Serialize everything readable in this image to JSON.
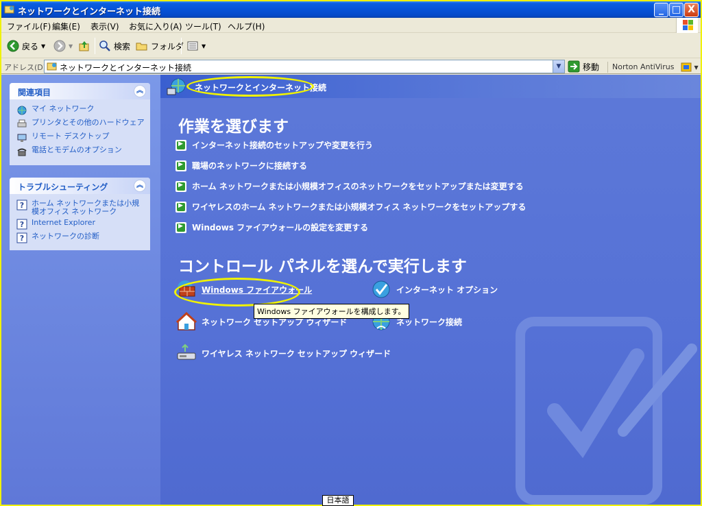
{
  "window": {
    "title": "ネットワークとインターネット接続",
    "buttons": {
      "minimize": "_",
      "maximize": "□",
      "close": "X"
    }
  },
  "menu": [
    "ファイル(F)",
    "編集(E)",
    "表示(V)",
    "お気に入り(A)",
    "ツール(T)",
    "ヘルプ(H)"
  ],
  "toolbar": {
    "back": "戻る",
    "search": "検索",
    "folders": "フォルダ"
  },
  "address": {
    "label": "アドレス(D)",
    "value": "ネットワークとインターネット接続",
    "go": "移動",
    "norton": "Norton AntiVirus"
  },
  "sidebar": {
    "related": {
      "title": "関連項目",
      "items": [
        {
          "label": "マイ ネットワーク",
          "icon": "globe-network-icon"
        },
        {
          "label": "プリンタとその他のハードウェア",
          "icon": "printer-icon"
        },
        {
          "label": "リモート デスクトップ",
          "icon": "remote-desktop-icon"
        },
        {
          "label": "電話とモデムのオプション",
          "icon": "phone-icon"
        }
      ]
    },
    "troubleshoot": {
      "title": "トラブルシューティング",
      "items": [
        {
          "label": "ホーム ネットワークまたは小規模オフィス ネットワーク",
          "icon": "help-icon"
        },
        {
          "label": "Internet Explorer",
          "icon": "help-icon"
        },
        {
          "label": "ネットワークの診断",
          "icon": "help-icon"
        }
      ]
    }
  },
  "main": {
    "banner_title": "ネットワークとインターネット接続",
    "section1_title": "作業を選びます",
    "tasks": [
      "インターネット接続のセットアップや変更を行う",
      "職場のネットワークに接続する",
      "ホーム ネットワークまたは小規模オフィスのネットワークをセットアップまたは変更する",
      "ワイヤレスのホーム ネットワークまたは小規模オフィス ネットワークをセットアップする",
      "Windows ファイアウォールの設定を変更する"
    ],
    "section2_title": "コントロール パネルを選んで実行します",
    "applets": [
      {
        "label": "Windows ファイアウォール",
        "icon": "firewall-icon"
      },
      {
        "label": "インターネット オプション",
        "icon": "internet-options-icon"
      },
      {
        "label": "ネットワーク セットアップ ウィザード",
        "icon": "network-setup-icon"
      },
      {
        "label": "ネットワーク接続",
        "icon": "network-connections-icon"
      },
      {
        "label": "ワイヤレス ネットワーク セットアップ ウィザード",
        "icon": "wireless-setup-icon"
      }
    ],
    "tooltip": "Windows ファイアウォールを構成します。"
  },
  "ime": "日本語",
  "colors": {
    "highlight": "#f0f200",
    "pane": "#5d79d8",
    "link": "#215dc6"
  }
}
